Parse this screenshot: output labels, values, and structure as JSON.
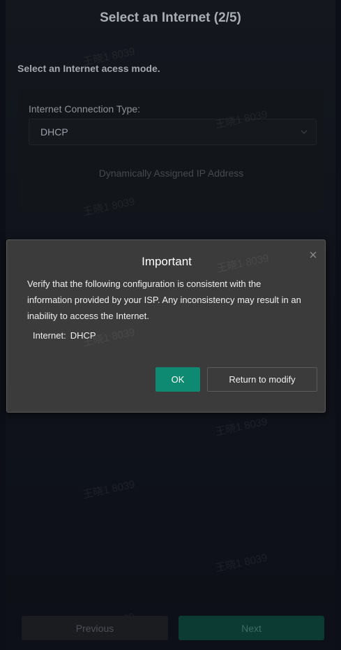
{
  "header": {
    "title": "Select an Internet (2/5)"
  },
  "main": {
    "subtitle": "Select an Internet acess mode.",
    "connection_label": "Internet Connection Type:",
    "connection_value": "DHCP",
    "connection_description": "Dynamically Assigned IP Address"
  },
  "dialog": {
    "title": "Important",
    "message": "Verify that the following configuration is consistent with the information provided by your ISP. Any inconsistency may result in an inability to access the Internet.",
    "field_label": "Internet:",
    "field_value": "DHCP",
    "ok_label": "OK",
    "return_label": "Return to modify"
  },
  "footer": {
    "previous_label": "Previous",
    "next_label": "Next"
  },
  "watermark": "王晓1 8039",
  "icons": {
    "close": "close-icon",
    "dropdown": "chevron-down-icon"
  },
  "colors": {
    "primary": "#0f8a72",
    "dialog_bg": "#3b3b3b",
    "page_bg": "#10131b"
  }
}
